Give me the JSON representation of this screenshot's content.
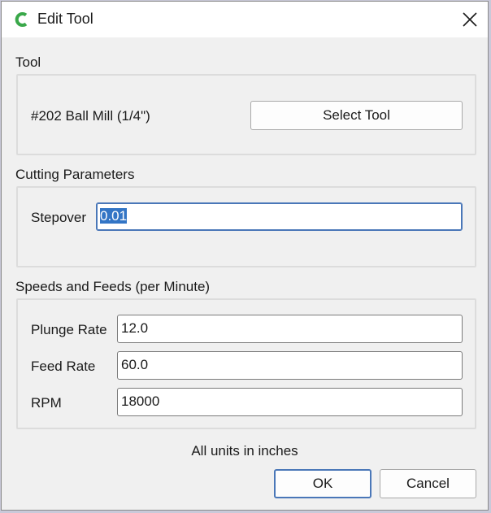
{
  "window": {
    "title": "Edit Tool",
    "close_label": "close"
  },
  "tool_section": {
    "label": "Tool",
    "tool_name": "#202 Ball Mill (1/4\")",
    "select_button": "Select Tool"
  },
  "cutting_section": {
    "label": "Cutting Parameters",
    "stepover_label": "Stepover",
    "stepover_value": "0.01"
  },
  "speeds_section": {
    "label": "Speeds and Feeds (per Minute)",
    "plunge_label": "Plunge Rate",
    "plunge_value": "12.0",
    "feed_label": "Feed Rate",
    "feed_value": "60.0",
    "rpm_label": "RPM",
    "rpm_value": "18000"
  },
  "footer": {
    "units_note": "All units in inches",
    "ok_button": "OK",
    "cancel_button": "Cancel"
  },
  "colors": {
    "accent": "#4a77b8",
    "selection": "#3375c5",
    "app_icon": "#3aa84a"
  },
  "icons": {
    "app": "app-logo-icon",
    "close": "close-icon"
  }
}
